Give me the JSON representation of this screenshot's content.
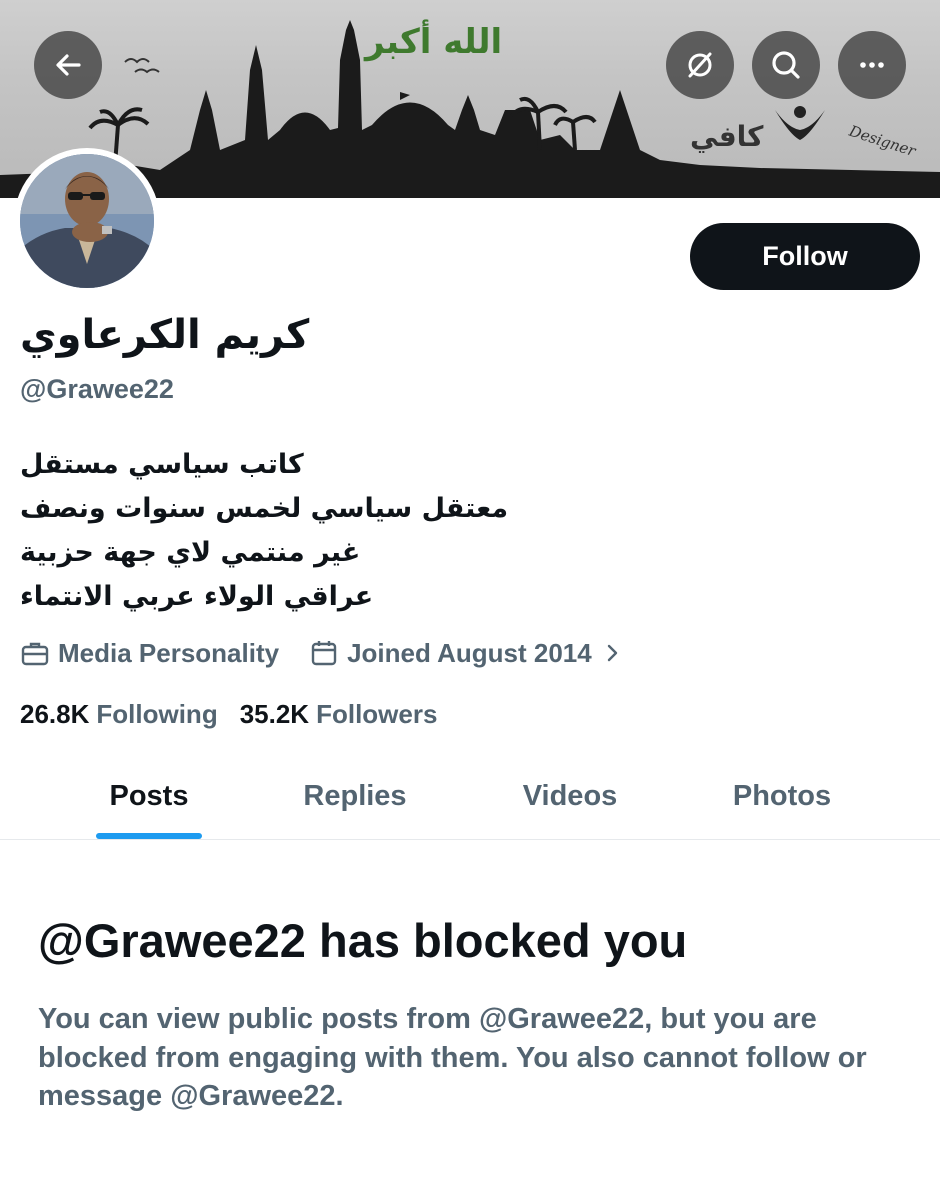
{
  "banner": {
    "caption": "الله أكبر",
    "logo_text": "كافي",
    "designer_text": "Designer"
  },
  "header_buttons": {
    "back_icon": "back-arrow-icon",
    "hide_icon": "eye-off-icon",
    "search_icon": "search-icon",
    "more_icon": "more-icon"
  },
  "profile": {
    "display_name": "كريم الكرعاوي",
    "handle": "@Grawee22",
    "bio_lines": [
      "كاتب سياسي مستقل",
      "معتقل سياسي لخمس سنوات ونصف",
      "غير منتمي لاي جهة حزبية",
      "عراقي الولاء عربي الانتماء"
    ],
    "category": "Media Personality",
    "joined": "Joined August 2014"
  },
  "follow_label": "Follow",
  "stats": {
    "following_count": "26.8K",
    "following_label": "Following",
    "followers_count": "35.2K",
    "followers_label": "Followers"
  },
  "tabs": [
    {
      "label": "Posts",
      "active": true
    },
    {
      "label": "Replies",
      "active": false
    },
    {
      "label": "Videos",
      "active": false
    },
    {
      "label": "Photos",
      "active": false
    }
  ],
  "blocked": {
    "title": "@Grawee22 has blocked you",
    "body": "You can view public posts from @Grawee22, but you are blocked from engaging with them. You also cannot follow or message @Grawee22."
  },
  "colors": {
    "text_primary": "#0f1419",
    "text_secondary": "#536471",
    "accent": "#1d9bf0"
  }
}
